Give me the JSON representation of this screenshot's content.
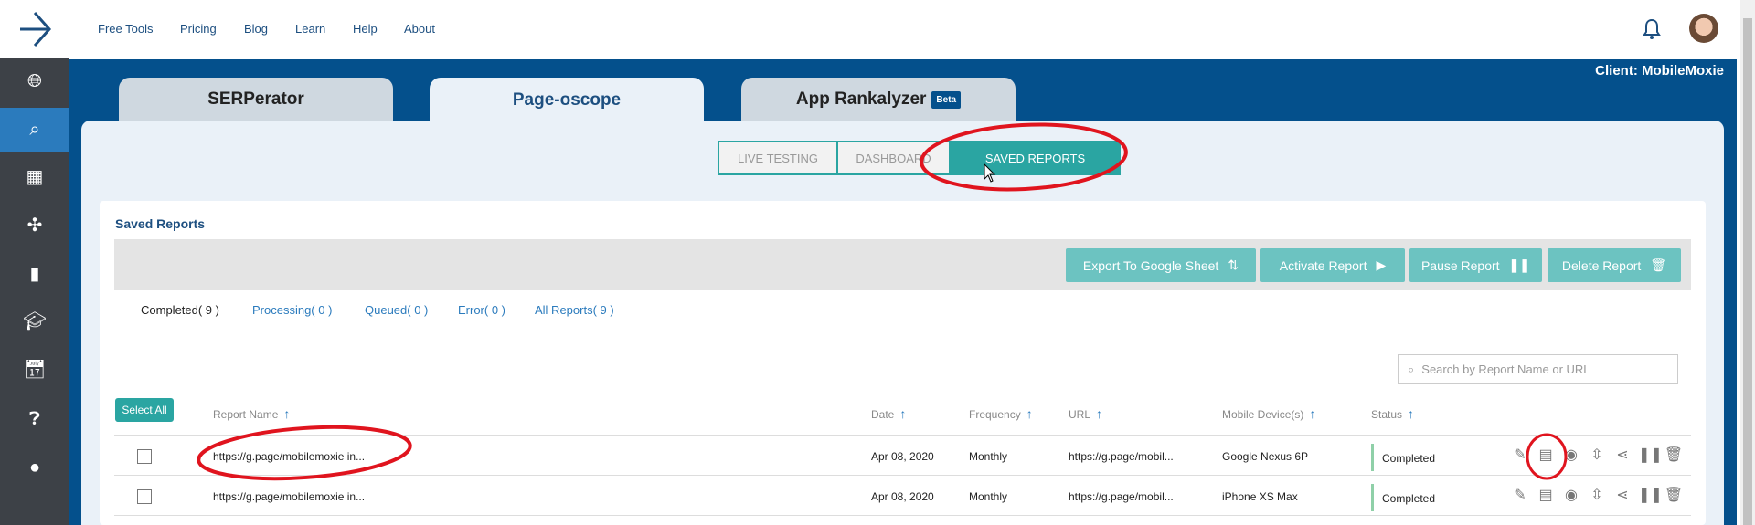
{
  "topnav": {
    "links": [
      "Free Tools",
      "Pricing",
      "Blog",
      "Learn",
      "Help",
      "About"
    ]
  },
  "client": "Client: MobileMoxie",
  "sidebar": {
    "icons": [
      "globe-icon",
      "search-icon",
      "grid-icon",
      "puzzle-icon",
      "chart-icon",
      "graduation-cap-icon",
      "calendar-clock-icon",
      "help-icon",
      "account-icon"
    ],
    "active": 1
  },
  "tabs": [
    {
      "label": "SERPerator"
    },
    {
      "label": "Page-oscope"
    },
    {
      "label": "App Rankalyzer",
      "badge": "Beta"
    }
  ],
  "subtabs": [
    "LIVE TESTING",
    "DASHBOARD",
    "SAVED REPORTS"
  ],
  "card": {
    "title": "Saved Reports"
  },
  "toolbar": {
    "export": "Export To Google Sheet",
    "activate": "Activate Report",
    "pause": "Pause Report",
    "delete": "Delete Report"
  },
  "filters": [
    "Completed( 9 )",
    "Processing( 0 )",
    "Queued( 0 )",
    "Error( 0 )",
    "All Reports( 9 )"
  ],
  "search": {
    "placeholder": "Search by Report Name or URL"
  },
  "table": {
    "select_all": "Select All",
    "headers": [
      "Report Name",
      "Date",
      "Frequency",
      "URL",
      "Mobile Device(s)",
      "Status"
    ],
    "rows": [
      {
        "name": "https://g.page/mobilemoxie in...",
        "date": "Apr 08, 2020",
        "frequency": "Monthly",
        "url": "https://g.page/mobil...",
        "device": "Google Nexus 6P",
        "status": "Completed"
      },
      {
        "name": "https://g.page/mobilemoxie in...",
        "date": "Apr 08, 2020",
        "frequency": "Monthly",
        "url": "https://g.page/mobil...",
        "device": "iPhone XS Max",
        "status": "Completed"
      }
    ]
  },
  "colors": {
    "brand_blue": "#04508c",
    "teal": "#2aa5a2",
    "annotation_red": "#e0141e"
  }
}
